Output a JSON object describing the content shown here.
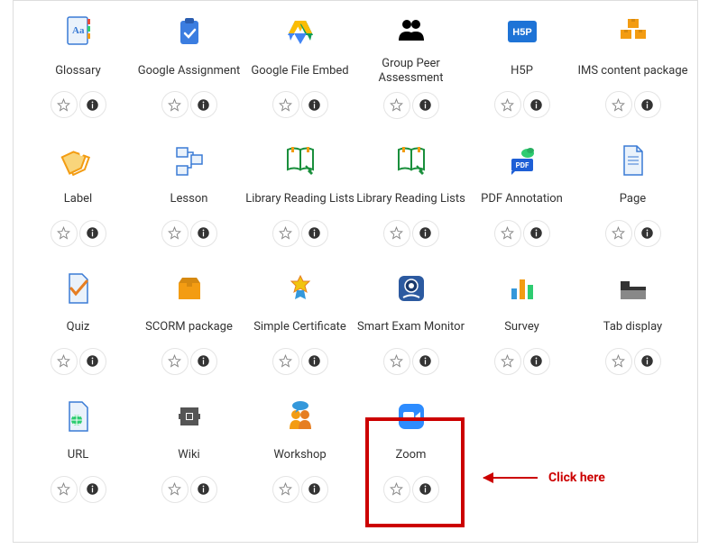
{
  "annotation": {
    "text": "Click here"
  },
  "activities": [
    {
      "id": "glossary",
      "label": "Glossary",
      "icon": "glossary"
    },
    {
      "id": "google-assignment",
      "label": "Google Assignment",
      "icon": "google-assignment"
    },
    {
      "id": "google-file-embed",
      "label": "Google File Embed",
      "icon": "google-drive"
    },
    {
      "id": "group-peer-assessment",
      "label": "Group Peer Assessment",
      "icon": "group"
    },
    {
      "id": "h5p",
      "label": "H5P",
      "icon": "h5p"
    },
    {
      "id": "ims-content-package",
      "label": "IMS content package",
      "icon": "package"
    },
    {
      "id": "label",
      "label": "Label",
      "icon": "label"
    },
    {
      "id": "lesson",
      "label": "Lesson",
      "icon": "lesson"
    },
    {
      "id": "library-reading-lists-1",
      "label": "Library Reading Lists",
      "icon": "reading-list"
    },
    {
      "id": "library-reading-lists-2",
      "label": "Library Reading Lists",
      "icon": "reading-list"
    },
    {
      "id": "pdf-annotation",
      "label": "PDF Annotation",
      "icon": "pdf"
    },
    {
      "id": "page",
      "label": "Page",
      "icon": "page"
    },
    {
      "id": "quiz",
      "label": "Quiz",
      "icon": "quiz"
    },
    {
      "id": "scorm-package",
      "label": "SCORM package",
      "icon": "scorm"
    },
    {
      "id": "simple-certificate",
      "label": "Simple Certificate",
      "icon": "certificate"
    },
    {
      "id": "smart-exam-monitor",
      "label": "Smart Exam Monitor",
      "icon": "monitor"
    },
    {
      "id": "survey",
      "label": "Survey",
      "icon": "survey"
    },
    {
      "id": "tab-display",
      "label": "Tab display",
      "icon": "tab"
    },
    {
      "id": "url",
      "label": "URL",
      "icon": "url"
    },
    {
      "id": "wiki",
      "label": "Wiki",
      "icon": "wiki"
    },
    {
      "id": "workshop",
      "label": "Workshop",
      "icon": "workshop"
    },
    {
      "id": "zoom",
      "label": "Zoom",
      "icon": "zoom",
      "highlighted": true
    }
  ]
}
